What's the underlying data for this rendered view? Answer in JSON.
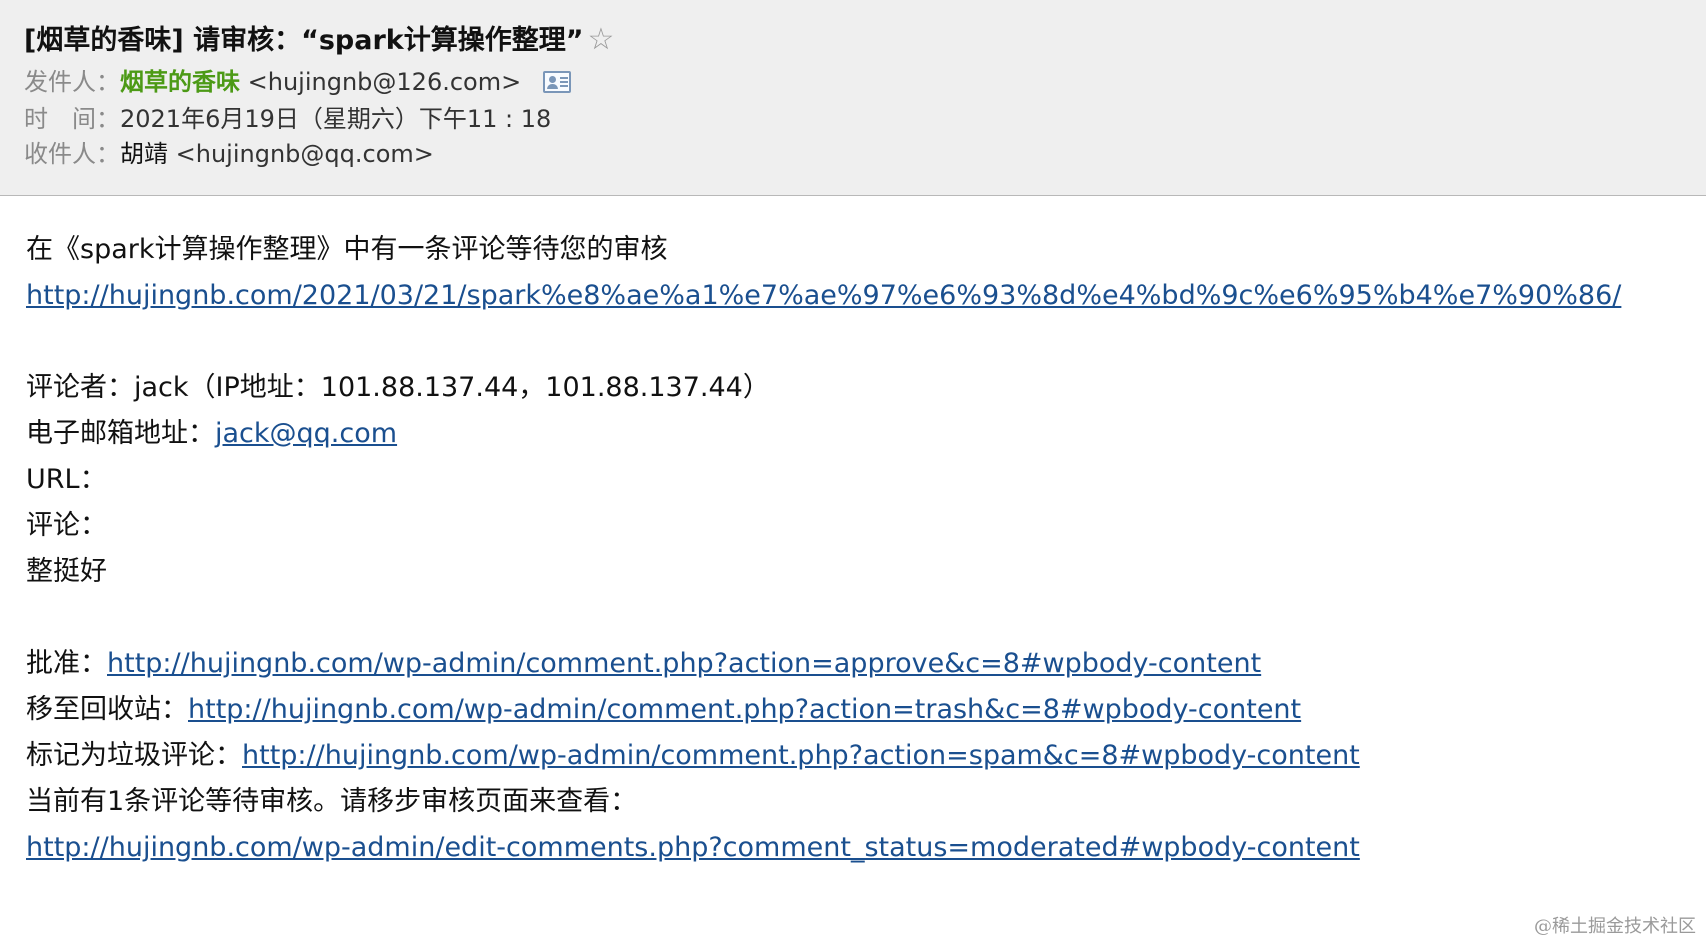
{
  "header": {
    "subject": "[烟草的香味] 请审核：“spark计算操作整理”",
    "star_glyph": "☆",
    "from_label": "发件人：",
    "from_name": "烟草的香味",
    "from_email": "<hujingnb@126.com>",
    "time_label": "时　间：",
    "time_value": "2021年6月19日（星期六）下午11 : 18",
    "to_label": "收件人：",
    "to_name": "胡靖",
    "to_email": "<hujingnb@qq.com>",
    "contact_icon": "contact-card-icon"
  },
  "body": {
    "intro": "在《spark计算操作整理》中有一条评论等待您的审核",
    "post_url": "http://hujingnb.com/2021/03/21/spark%e8%ae%a1%e7%ae%97%e6%93%8d%e4%bd%9c%e6%95%b4%e7%90%86/",
    "commenter_line": "评论者：jack（IP地址：101.88.137.44，101.88.137.44）",
    "email_label": "电子邮箱地址：",
    "email_value": "jack@qq.com",
    "url_label": "URL：",
    "comment_label": "评论：",
    "comment_text": "整挺好",
    "approve_label": "批准：",
    "approve_url": "http://hujingnb.com/wp-admin/comment.php?action=approve&c=8#wpbody-content",
    "trash_label": "移至回收站：",
    "trash_url": "http://hujingnb.com/wp-admin/comment.php?action=trash&c=8#wpbody-content",
    "spam_label": "标记为垃圾评论：",
    "spam_url": "http://hujingnb.com/wp-admin/comment.php?action=spam&c=8#wpbody-content",
    "pending_text": "当前有1条评论等待审核。请移步审核页面来查看：",
    "moderate_url": "http://hujingnb.com/wp-admin/edit-comments.php?comment_status=moderated#wpbody-content"
  },
  "watermark": "@稀土掘金技术社区",
  "colors": {
    "header_bg": "#efefef",
    "sender_green": "#4c9a16",
    "link_blue": "#1a4f8f",
    "label_gray": "#8a8a8a"
  }
}
